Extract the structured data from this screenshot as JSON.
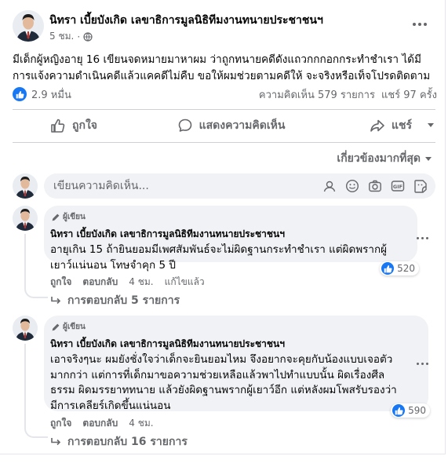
{
  "post": {
    "author": "นิทรา เบี้ยบังเกิด เลขาธิการมูลนิธิทีมงานทนายประชาชนฯ",
    "time": "5 ชม.",
    "text_lines": [
      "มีเด็กผู้หญิงอายุ 16 เขียนจดหมายมาหาผม ว่าถูกทนายคดีดังแถวกกกอกกระทำชำเรา ได้มี",
      "การแจ้งความดำเนินคดีแล้วแคคดีไม่คืบ ขอให้ผมช่วยตามคดีให้ จะจริงหรือเท็จโปรดติดตาม"
    ],
    "reactions": "2.9 หมื่น",
    "comments_count": "ความคิดเห็น 579 รายการ",
    "shares_count": "แชร์ 97 ครั้ง"
  },
  "actions": {
    "like": "ถูกใจ",
    "comment": "แสดงความคิดเห็น",
    "share": "แชร์"
  },
  "sort_label": "เกี่ยวข้องมากที่สุด",
  "compose": {
    "placeholder": "เขียนความคิดเห็น..."
  },
  "comments": [
    {
      "author_badge": "ผู้เขียน",
      "name": "นิทรา เบี้ยบังเกิด เลขาธิการมูลนิธิทีมงานทนายประชาชนฯ",
      "text_lines": [
        "อายุเกิน 15 ถ้ายินยอมมีเพศสัมพันธ์จะไม่ผิดฐานกระทำชำเรา แต่ผิดพรากผู้",
        "เยาว์แน่นอน โทษจำคุก 5 ปี"
      ],
      "like_label": "ถูกใจ",
      "reply_label": "ตอบกลับ",
      "time": "4 ชม.",
      "edited": "แก้ไขแล้ว",
      "reactions": "520",
      "replies": "การตอบกลับ 5 รายการ"
    },
    {
      "author_badge": "ผู้เขียน",
      "name": "นิทรา เบี้ยบังเกิด เลขาธิการมูลนิธิทีมงานทนายประชาชนฯ",
      "text_lines": [
        "เอาจริงๆนะ ผมยังชั่งใจว่าเด็กจะยินยอมไหม จึงอยากจะคุยกับน้องแบบเจอตัว",
        "มากกว่า แต่การที่เด็กมาขอความช่วยเหลือแล้วพาไปทำแบบนั้น ผิดเรื่องศีล",
        "ธรรม ผิดมรรยาททนาย แล้วยังผิดฐานพรากผู้เยาว์อีก แต่หลังผมโพสรับรองว่า",
        "มีการเคลียร์เกิดขึ้นแน่นอน"
      ],
      "like_label": "ถูกใจ",
      "reply_label": "ตอบกลับ",
      "time": "4 ชม.",
      "edited": "",
      "reactions": "590",
      "replies": "การตอบกลับ 16 รายการ"
    }
  ],
  "colors": {
    "brand": "#1877f2",
    "secondary_text": "#65676b",
    "bubble": "#f0f2f5"
  },
  "icons": [
    "globe-icon",
    "more-icon",
    "like-icon",
    "comment-icon",
    "share-icon",
    "pen-icon",
    "reply-arrow-icon",
    "emoji-icon",
    "camera-icon",
    "gif-icon",
    "sticker-icon",
    "avatar-sticker-icon"
  ]
}
